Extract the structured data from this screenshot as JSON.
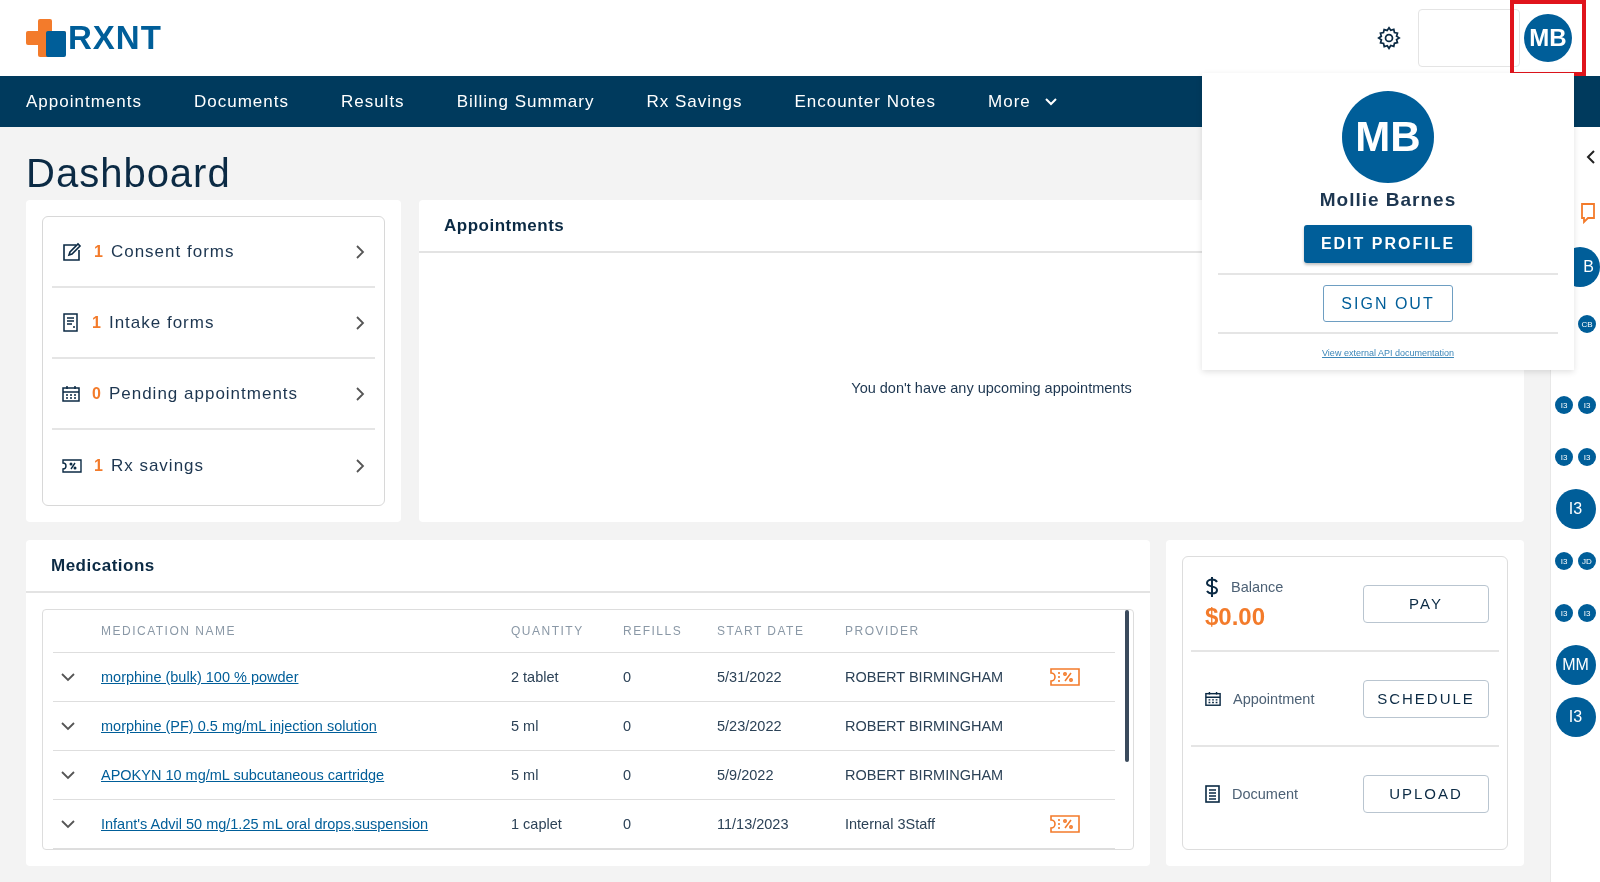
{
  "header": {
    "logo": "RXNT",
    "avatar": "MB"
  },
  "nav": [
    {
      "label": "Appointments",
      "kind": "link"
    },
    {
      "label": "Documents",
      "kind": "link"
    },
    {
      "label": "Results",
      "kind": "link"
    },
    {
      "label": "Billing Summary",
      "kind": "link"
    },
    {
      "label": "Rx Savings",
      "kind": "link"
    },
    {
      "label": "Encounter Notes",
      "kind": "link"
    },
    {
      "label": "More",
      "kind": "menu"
    }
  ],
  "title": "Dashboard",
  "tasks": [
    {
      "kind": "consent",
      "count": "1",
      "label": "Consent forms"
    },
    {
      "kind": "intake",
      "count": "1",
      "label": "Intake forms"
    },
    {
      "kind": "calendar",
      "count": "0",
      "label": "Pending appointments"
    },
    {
      "kind": "coupon",
      "count": "1",
      "label": "Rx savings"
    }
  ],
  "appointments": {
    "title": "Appointments",
    "empty": "You don't have any upcoming appointments"
  },
  "medications": {
    "title": "Medications",
    "columns": [
      "MEDICATION NAME",
      "QUANTITY",
      "REFILLS",
      "START DATE",
      "PROVIDER"
    ],
    "rows": [
      {
        "name": "morphine (bulk) 100 % powder",
        "quantity": "2 tablet",
        "refills": "0",
        "start_date": "5/31/2022",
        "provider": "ROBERT BIRMINGHAM",
        "coupon": true
      },
      {
        "name": "morphine (PF) 0.5 mg/mL injection solution",
        "quantity": "5 ml",
        "refills": "0",
        "start_date": "5/23/2022",
        "provider": "ROBERT BIRMINGHAM",
        "coupon": false
      },
      {
        "name": "APOKYN 10 mg/mL subcutaneous cartridge",
        "quantity": "5 ml",
        "refills": "0",
        "start_date": "5/9/2022",
        "provider": "ROBERT BIRMINGHAM",
        "coupon": false
      },
      {
        "name": "Infant's Advil 50 mg/1.25 mL oral drops,suspension",
        "quantity": "1 caplet",
        "refills": "0",
        "start_date": "11/13/2023",
        "provider": "Internal 3Staff",
        "coupon": true
      }
    ]
  },
  "account": {
    "balance_label": "Balance",
    "amount": "$0.00",
    "pay": "PAY",
    "items": [
      {
        "kind": "calendar",
        "label": "Appointment",
        "button": "SCHEDULE"
      },
      {
        "kind": "document",
        "label": "Document",
        "button": "UPLOAD"
      }
    ]
  },
  "profile_menu": {
    "initials": "MB",
    "name": "Mollie Barnes",
    "edit": "EDIT PROFILE",
    "sign_out": "SIGN OUT",
    "link": "View external API documentation"
  },
  "side_strip": {
    "top_avatar": "B",
    "rows": [
      [
        "CB"
      ],
      [
        "I3",
        "I3"
      ],
      [
        "I3",
        "I3"
      ],
      [
        "I3"
      ],
      [
        "I3",
        "JD"
      ],
      [
        "I3",
        "I3"
      ],
      [
        "MM"
      ],
      [
        "I3"
      ]
    ]
  }
}
